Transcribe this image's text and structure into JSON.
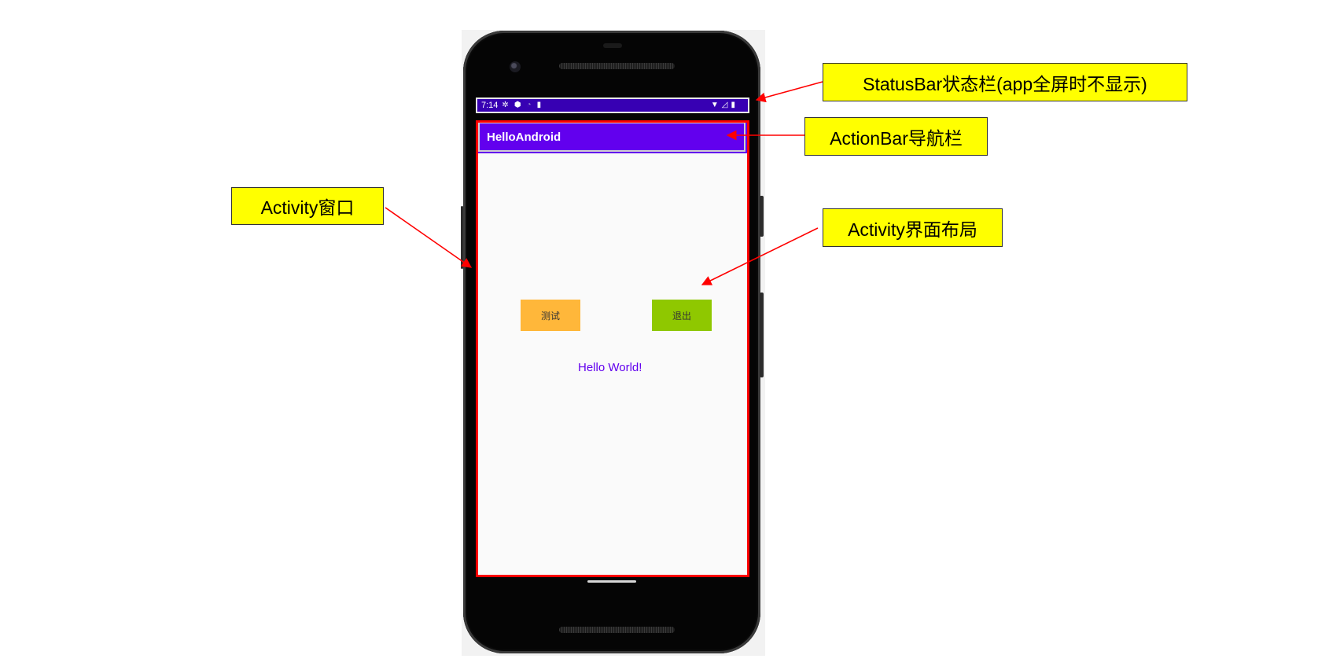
{
  "phone": {
    "status_bar": {
      "time": "7:14",
      "icons_left": [
        "gear-icon",
        "shield-icon",
        "wifi-calling-icon",
        "sd-card-icon"
      ],
      "icons_right": [
        "wifi-icon",
        "signal-icon",
        "battery-icon"
      ]
    },
    "action_bar": {
      "title": "HelloAndroid"
    },
    "layout": {
      "buttons": [
        {
          "label": "测试",
          "color": "#ffb73a"
        },
        {
          "label": "退出",
          "color": "#8fc800"
        }
      ],
      "text": "Hello World!"
    }
  },
  "annotations": {
    "status_bar": "StatusBar状态栏(app全屏时不显示)",
    "action_bar": "ActionBar导航栏",
    "activity_window": "Activity窗口",
    "activity_layout": "Activity界面布局"
  },
  "colors": {
    "primary": "#6200ee",
    "primary_dark": "#3700b3",
    "annotation_bg": "#ffff00",
    "annotation_arrow": "#ff0000"
  }
}
